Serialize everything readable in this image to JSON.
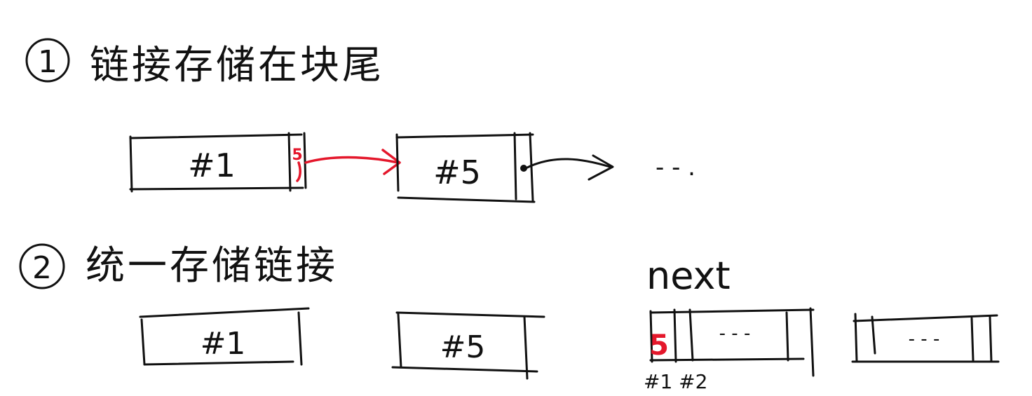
{
  "section1": {
    "number": "1",
    "heading": "链接存储在块尾",
    "block_a_label": "#1",
    "pointer_value": "5",
    "block_b_label": "#5",
    "continuation": "- - ."
  },
  "section2": {
    "number": "2",
    "heading": "统一存储链接",
    "block_a_label": "#1",
    "block_b_label": "#5",
    "next_label": "next",
    "table_first_value": "5",
    "table_ellipsis": "- - -",
    "table_right_ellipsis": "- - -",
    "table_index_label": "#1 #2"
  },
  "colors": {
    "ink": "#111111",
    "pointer_red": "#e4172b"
  }
}
